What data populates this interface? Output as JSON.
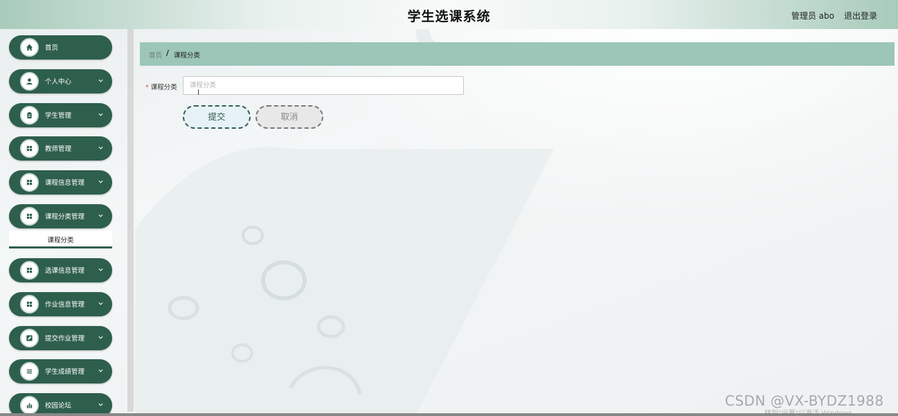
{
  "header": {
    "title": "学生选课系统",
    "user": "管理员 abo",
    "logout": "退出登录"
  },
  "sidebar": {
    "items": [
      {
        "label": "首页",
        "icon": "home-icon",
        "has_chevron": false
      },
      {
        "label": "个人中心",
        "icon": "user-icon",
        "has_chevron": true
      },
      {
        "label": "学生管理",
        "icon": "clipboard-icon",
        "has_chevron": true
      },
      {
        "label": "教师管理",
        "icon": "grid-icon",
        "has_chevron": true
      },
      {
        "label": "课程信息管理",
        "icon": "grid-icon",
        "has_chevron": true
      },
      {
        "label": "课程分类管理",
        "icon": "grid-icon",
        "has_chevron": true
      },
      {
        "label": "选课信息管理",
        "icon": "grid-icon",
        "has_chevron": true
      },
      {
        "label": "作业信息管理",
        "icon": "grid-icon",
        "has_chevron": true
      },
      {
        "label": "提交作业管理",
        "icon": "edit-icon",
        "has_chevron": true
      },
      {
        "label": "学生成绩管理",
        "icon": "list-icon",
        "has_chevron": true
      },
      {
        "label": "校园论坛",
        "icon": "chart-icon",
        "has_chevron": true
      }
    ],
    "submenu_active": "课程分类"
  },
  "breadcrumb": {
    "home": "首页",
    "separator": "/",
    "current": "课程分类"
  },
  "form": {
    "label": "课程分类",
    "required_mark": "*",
    "placeholder": "课程分类",
    "value": ""
  },
  "buttons": {
    "submit": "提交",
    "cancel": "取消"
  },
  "watermark": {
    "line1": "CSDN @VX-BYDZ1988",
    "line2": "转到\"设置\"以激活 Windows。"
  },
  "colors": {
    "sidebar_item_bg": "#2e5f4d",
    "breadcrumb_bg": "#9cc6b8",
    "header_gradient_edge": "#a8cbbb"
  }
}
